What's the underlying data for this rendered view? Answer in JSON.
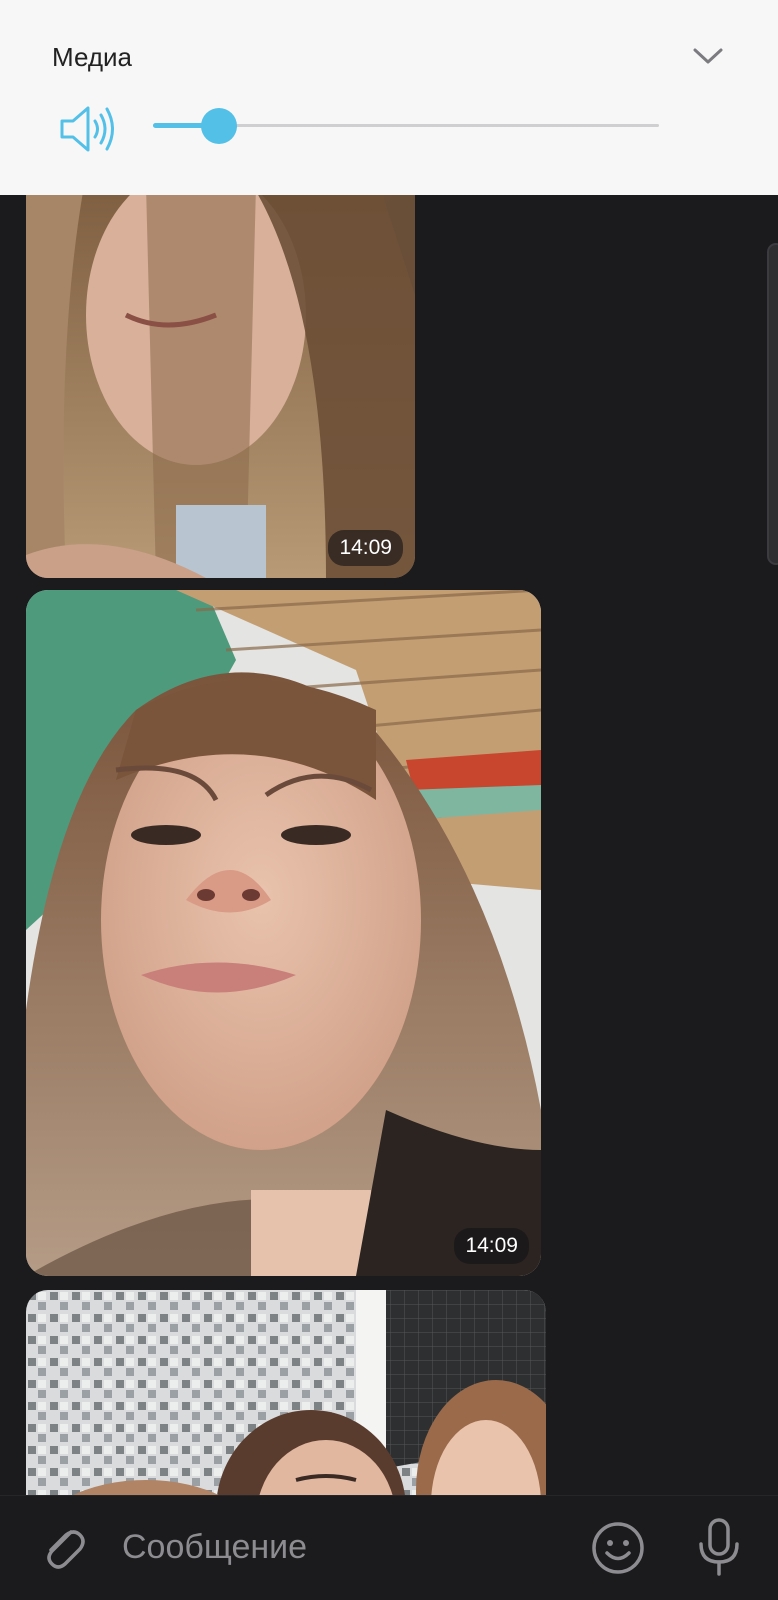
{
  "volume_panel": {
    "title": "Медиа",
    "icon": "speaker-icon",
    "collapse_icon": "chevron-down-icon",
    "level_fraction": 0.13,
    "accent_color": "#53c0e8"
  },
  "messages": [
    {
      "type": "photo",
      "time": "14:09"
    },
    {
      "type": "photo",
      "time": "14:09"
    },
    {
      "type": "photo",
      "time": ""
    }
  ],
  "composer": {
    "placeholder": "Сообщение",
    "attach_icon": "paperclip-icon",
    "emoji_icon": "smiley-icon",
    "mic_icon": "microphone-icon"
  }
}
